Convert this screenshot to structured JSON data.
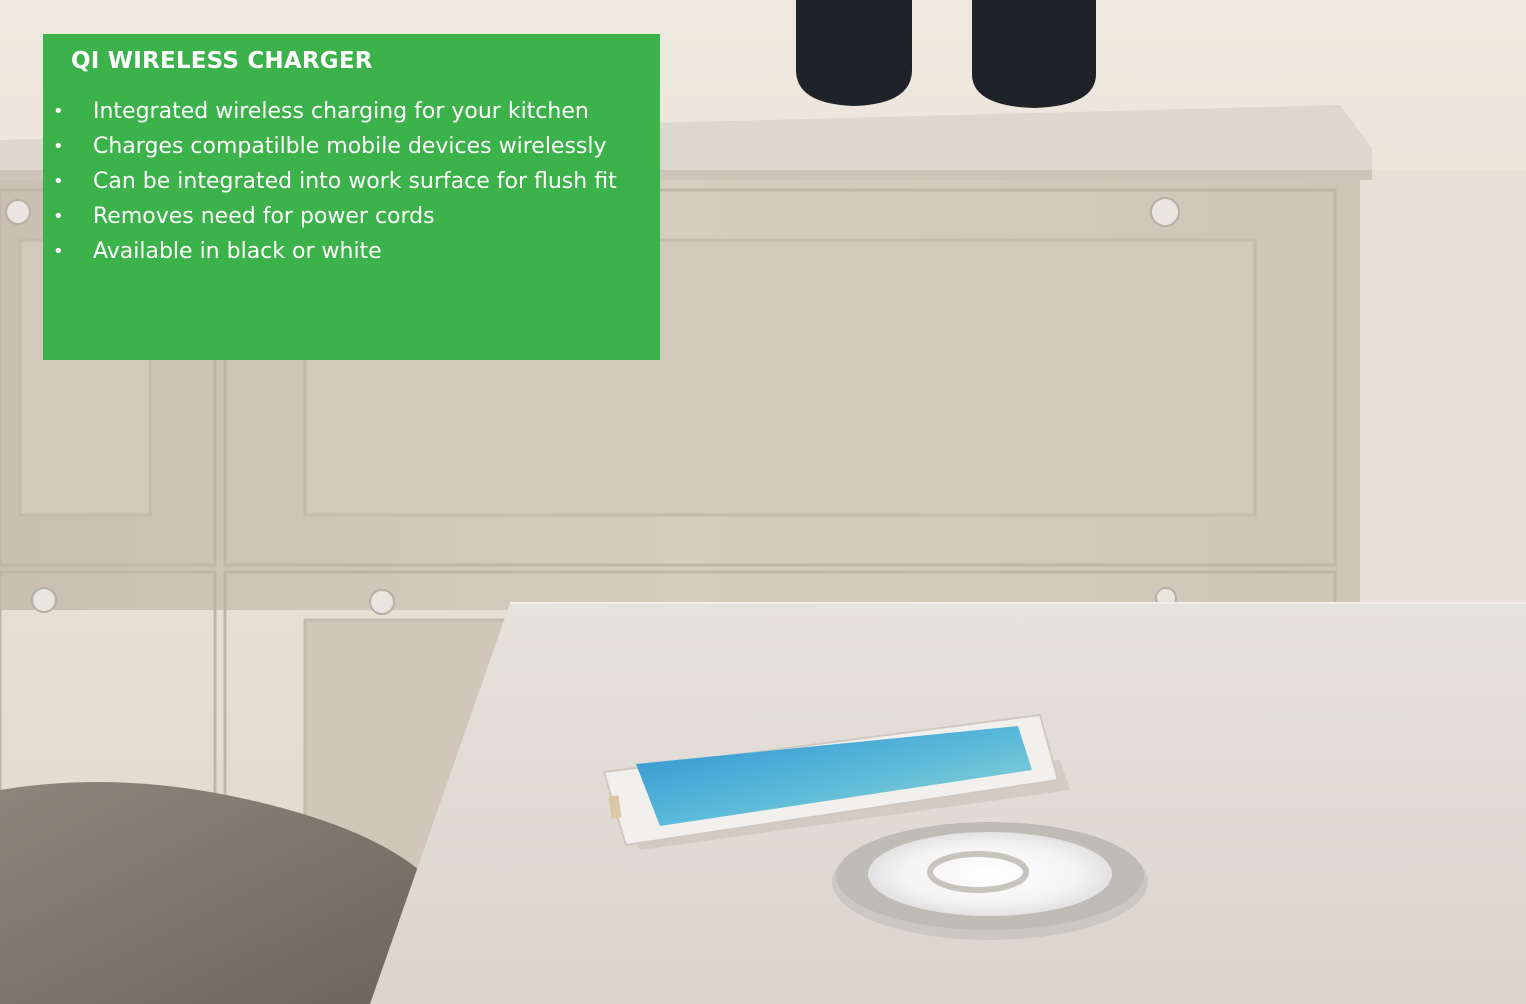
{
  "panel": {
    "title": "QI WIRELESS CHARGER",
    "features": [
      "Integrated wireless charging for your kitchen",
      "Charges compatilble mobile devices wirelessly",
      "Can be integrated into work surface for flush fit",
      "Removes need for power cords",
      "Available in black or white"
    ],
    "bullet": "•",
    "background_color": "#3bb24a",
    "text_color": "#ffffff"
  },
  "photo": {
    "subject": "smartphone-on-flush-wireless-charger",
    "colors": {
      "cabinet": "#d6ccbf",
      "worktop": "#ddd7cf",
      "table": "#e3dfda",
      "vase": "#1f2328"
    }
  }
}
